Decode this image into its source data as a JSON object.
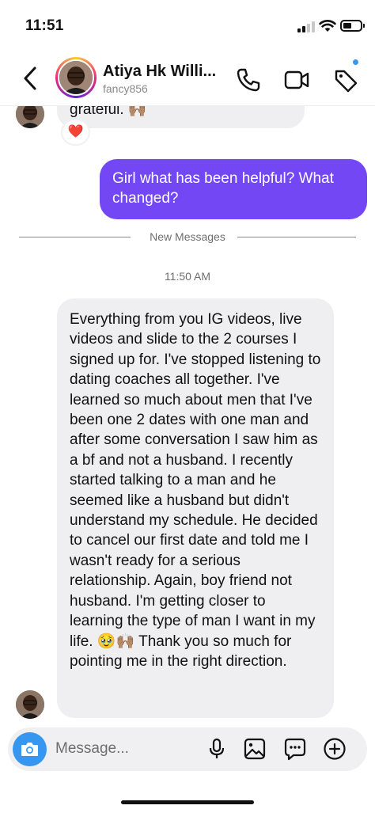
{
  "status": {
    "time": "11:51"
  },
  "header": {
    "name": "Atiya Hk Willi...",
    "handle": "fancy856"
  },
  "messages": {
    "received_top": "grateful. 🙌🏽",
    "received_top_reaction": "❤️",
    "sent": "Girl what has been helpful? What changed?",
    "divider_label": "New Messages",
    "timestamp": "11:50 AM",
    "received_long": "Everything from you IG videos, live videos and slide to the 2 courses I signed up for. I've stopped listening to dating coaches all together. I've learned so much about men that I've been one 2 dates with one man and after some conversation I saw him as a bf and not a husband. I recently started talking to a man and he seemed like a husband but didn't understand my schedule. He decided to cancel our first date and told me I wasn't ready for a serious relationship. Again, boy friend not husband. I'm getting closer to learning the type of man I want in my life. 🥹🙌🏽 Thank you so much for pointing me in the right direction."
  },
  "composer": {
    "placeholder": "Message..."
  },
  "colors": {
    "sent_bubble": "#7447f5",
    "received_bubble": "#efeff1",
    "accent_blue": "#3797f0"
  },
  "icons": [
    "back-icon",
    "phone-icon",
    "video-icon",
    "tag-icon",
    "camera-icon",
    "mic-icon",
    "gallery-icon",
    "sticker-icon",
    "plus-icon"
  ]
}
